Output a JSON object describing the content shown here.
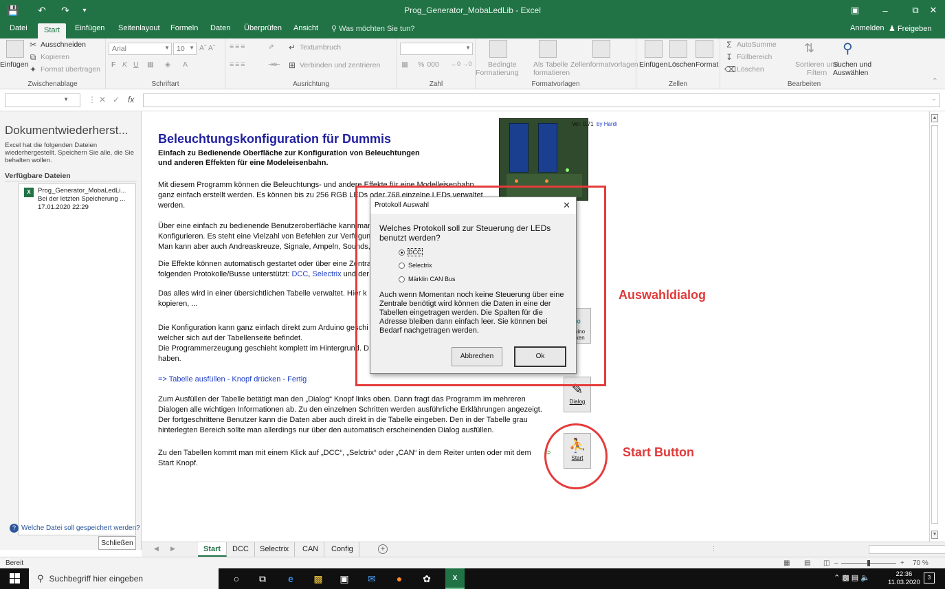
{
  "window": {
    "title": "Prog_Generator_MobaLedLib - Excel",
    "qa_save_icon": "save-icon",
    "qa_undo_icon": "undo-icon",
    "qa_redo_icon": "redo-icon"
  },
  "ribbon_tabs": [
    "Datei",
    "Start",
    "Einfügen",
    "Seitenlayout",
    "Formeln",
    "Daten",
    "Überprüfen",
    "Ansicht"
  ],
  "ribbon_tellme": "Was möchten Sie tun?",
  "account": {
    "signin": "Anmelden",
    "share": "Freigeben"
  },
  "clipboard": {
    "paste": "Einfügen",
    "cut": "Ausschneiden",
    "copy": "Kopieren",
    "format_painter": "Format übertragen",
    "label": "Zwischenablage"
  },
  "font": {
    "name": "Arial",
    "size": "10",
    "bold": "F",
    "italic": "K",
    "underline": "U",
    "label": "Schriftart"
  },
  "alignment": {
    "wrap": "Textumbruch",
    "merge": "Verbinden und zentrieren",
    "label": "Ausrichtung"
  },
  "number": {
    "format_value": "",
    "percent": "%",
    "thousands": "000",
    "label": "Zahl"
  },
  "styles": {
    "conditional_line1": "Bedingte",
    "conditional_line2": "Formatierung",
    "as_table_line1": "Als Tabelle",
    "as_table_line2": "formatieren",
    "cell_styles": "Zellenformatvorlagen",
    "label": "Formatvorlagen"
  },
  "cells": {
    "insert": "Einfügen",
    "delete": "Löschen",
    "format": "Format",
    "label": "Zellen"
  },
  "editing": {
    "autosum": "AutoSumme",
    "fill": "Füllbereich",
    "clear": "Löschen",
    "sort_line1": "Sortieren und",
    "sort_line2": "Filtern",
    "find_line1": "Suchen und",
    "find_line2": "Auswählen",
    "label": "Bearbeiten"
  },
  "formula_bar": {
    "name_box": "",
    "fx": "fx",
    "formula": ""
  },
  "recovery": {
    "title": "Dokumentwiederherst...",
    "description": "Excel hat die folgenden Dateien wiederhergestellt. Speichern Sie alle, die Sie behalten wollen.",
    "files_header": "Verfügbare Dateien",
    "file_name": "Prog_Generator_MobaLedLi...",
    "file_status": "Bei der letzten Speicherung ...",
    "file_date": "17.01.2020 22:29",
    "question": "Welche Datei soll gespeichert werden?",
    "close": "Schließen"
  },
  "sheet": {
    "version": "Ver. 0.71",
    "by": "by Hardi",
    "title": "Beleuchtungskonfiguration für Dummis",
    "subtitle1": "Einfach zu Bedienende  Oberfläche zur Konfiguration von Beleuchtungen",
    "subtitle2": "und anderen Effekten für eine Modeleisenbahn.",
    "p1_l1": "Mit diesem Programm können die Beleuchtungs- und andere Effekte für eine Modelleisenbahn",
    "p1_l2": "ganz einfach erstellt werden. Es können bis zu 256 RGB LEDs oder 768 einzelne LEDs verwaltet",
    "p1_l3": "werden.",
    "p2_l1": "Über eine einfach zu bedienende Benutzeroberfläche kann man",
    "p2_l2": "Konfigurieren. Es steht eine Vielzahl von Befehlen zur Verfügung",
    "p2_l3": "Man kann aber auch Andreaskreuze, Signale, Ampeln, Sounds,",
    "p3_l1": "Die Effekte können automatisch gestartet oder über eine Zentrale",
    "p3_l2_pre": "folgenden Protokolle/Busse unterstützt: ",
    "p3_dcc": "DCC",
    "p3_sep": ", ",
    "p3_sx": "Selectrix",
    "p3_l2_post": " und der",
    "p4_l1": "Das alles wird in einer übersichtlichen Tabelle verwaltet. Hier k",
    "p4_l2": "kopieren,  ...",
    "p5_l1": "Die Konfiguration kann ganz einfach direkt zum Arduino geschi",
    "p5_l2": "welcher sich auf der Tabellenseite befindet.",
    "p5_l3": "Die Programmerzeugung geschieht komplett im Hintergrund. D",
    "p5_l4": "haben.",
    "fill_line": "=> Tabelle ausfüllen - Knopf drücken - Fertig",
    "p6_l1": "Zum Ausfüllen der Tabelle betätigt man den „Dialog“ Knopf links oben. Dann fragt das Programm im mehreren",
    "p6_l2": "Dialogen alle wichtigen Informationen ab. Zu den einzelnen Schritten werden ausführliche Erklährungen angezeigt.",
    "p6_l3": "Der fortgeschrittene Benutzer kann die Daten aber auch direkt in die Tabelle eingeben. Den in der Tabelle grau",
    "p6_l4": "hinterlegten Bereich sollte man allerdings nur über den automatisch erscheinenden Dialog ausfüllen.",
    "p7_l1": "Zu den Tabellen kommt man mit einem Klick auf „DCC“, „Selctrix“ oder „CAN“ in dem Reiter unten oder mit dem",
    "p7_l2": "Start Knopf.",
    "btn_arduino_l1": "rduino",
    "btn_arduino_l2": "ücken",
    "btn_dialog": "Dialog",
    "btn_start": "Start"
  },
  "annotations": {
    "dialog_label": "Auswahldialog",
    "start_label": "Start Button",
    "color": "#e53b3b"
  },
  "dialog": {
    "title": "Protokoll Auswahl",
    "question": "Welches Protokoll soll zur Steuerung der LEDs benutzt werden?",
    "options": [
      {
        "label": "DCC",
        "selected": true
      },
      {
        "label": "Selectrix",
        "selected": false
      },
      {
        "label": "Märklin CAN Bus",
        "selected": false
      }
    ],
    "info": "Auch wenn Momentan noch keine Steuerung über eine Zentrale benötigt wird können die Daten in eine der Tabellen eingetragen werden. Die Spalten für die Adresse bleiben dann einfach leer. Sie können bei Bedarf nachgetragen werden.",
    "cancel": "Abbrechen",
    "ok": "Ok"
  },
  "sheet_tabs": [
    {
      "label": "Start",
      "active": true
    },
    {
      "label": "DCC",
      "active": false
    },
    {
      "label": "Selectrix",
      "active": false
    },
    {
      "label": "CAN",
      "active": false
    },
    {
      "label": "Config",
      "active": false
    }
  ],
  "statusbar": {
    "ready": "Bereit",
    "zoom": "70 %"
  },
  "taskbar": {
    "search": "Suchbegriff hier eingeben",
    "time": "22:36",
    "date": "11.03.2020",
    "notifications": "3"
  },
  "colors": {
    "excel_green": "#217346",
    "link_blue": "#1f3fc8",
    "title_blue": "#1f1fa0"
  }
}
